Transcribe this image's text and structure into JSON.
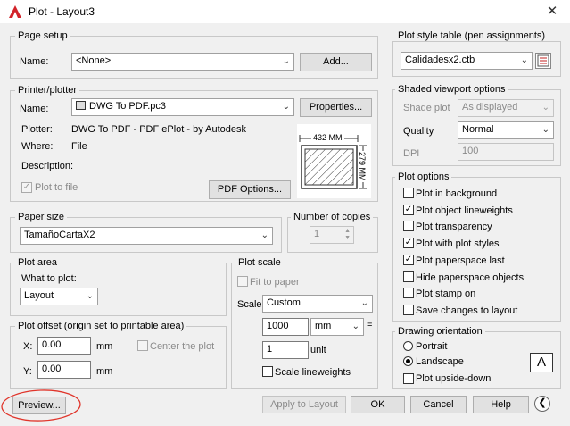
{
  "window": {
    "title": "Plot - Layout3"
  },
  "page_setup": {
    "group": "Page setup",
    "name_label": "Name:",
    "name_value": "<None>",
    "add_button": "Add..."
  },
  "printer": {
    "group": "Printer/plotter",
    "name_label": "Name:",
    "name_value": "DWG To PDF.pc3",
    "properties_button": "Properties...",
    "plotter_label": "Plotter:",
    "plotter_value": "DWG To PDF - PDF ePlot - by Autodesk",
    "where_label": "Where:",
    "where_value": "File",
    "description_label": "Description:",
    "plot_to_file": "Plot to file",
    "pdf_options_button": "PDF Options...",
    "preview_width": "432 MM",
    "preview_height": "279 MM"
  },
  "paper_size": {
    "group": "Paper size",
    "value": "TamañoCartaX2"
  },
  "copies": {
    "group": "Number of copies",
    "value": "1"
  },
  "plot_area": {
    "group": "Plot area",
    "what_label": "What to plot:",
    "what_value": "Layout"
  },
  "plot_offset": {
    "group": "Plot offset (origin set to printable area)",
    "x_label": "X:",
    "x_value": "0.00",
    "y_label": "Y:",
    "y_value": "0.00",
    "unit": "mm",
    "center_label": "Center the plot"
  },
  "plot_scale": {
    "group": "Plot scale",
    "fit_label": "Fit to paper",
    "scale_label": "Scale:",
    "scale_value": "Custom",
    "value1": "1000",
    "unit1": "mm",
    "equals": "=",
    "value2": "1",
    "unit2": "unit",
    "scale_lineweights": "Scale lineweights"
  },
  "style_table": {
    "group": "Plot style table (pen assignments)",
    "value": "Calidadesx2.ctb"
  },
  "shaded": {
    "group": "Shaded viewport options",
    "shade_label": "Shade plot",
    "shade_value": "As displayed",
    "quality_label": "Quality",
    "quality_value": "Normal",
    "dpi_label": "DPI",
    "dpi_value": "100"
  },
  "plot_options": {
    "group": "Plot options",
    "items": [
      {
        "label": "Plot in background",
        "checked": false
      },
      {
        "label": "Plot object lineweights",
        "checked": true
      },
      {
        "label": "Plot transparency",
        "checked": false
      },
      {
        "label": "Plot with plot styles",
        "checked": true
      },
      {
        "label": "Plot paperspace last",
        "checked": true
      },
      {
        "label": "Hide paperspace objects",
        "checked": false
      },
      {
        "label": "Plot stamp on",
        "checked": false
      },
      {
        "label": "Save changes to layout",
        "checked": false
      }
    ]
  },
  "orientation": {
    "group": "Drawing orientation",
    "portrait": "Portrait",
    "landscape": "Landscape",
    "upside_down": "Plot upside-down",
    "selected": "landscape",
    "icon_letter": "A"
  },
  "footer": {
    "preview": "Preview...",
    "apply": "Apply to Layout",
    "ok": "OK",
    "cancel": "Cancel",
    "help": "Help"
  },
  "colors": {
    "annotation_circle": "#e0352b",
    "autocad_red": "#d2232a"
  }
}
